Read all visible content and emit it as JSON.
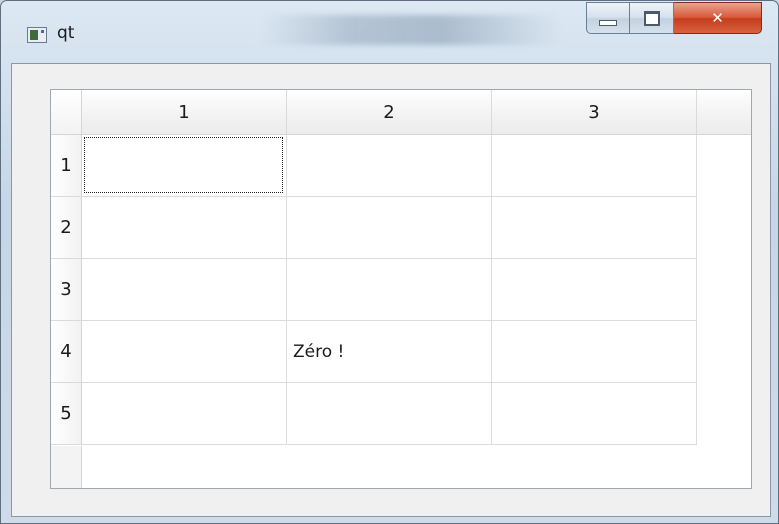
{
  "window": {
    "title": "qt"
  },
  "table": {
    "columns": [
      "1",
      "2",
      "3"
    ],
    "rows": [
      "1",
      "2",
      "3",
      "4",
      "5"
    ],
    "cells": [
      [
        "",
        "",
        ""
      ],
      [
        "",
        "",
        ""
      ],
      [
        "",
        "",
        ""
      ],
      [
        "",
        "Zéro !",
        ""
      ],
      [
        "",
        "",
        ""
      ]
    ],
    "focused_cell": {
      "row": 0,
      "col": 0
    }
  },
  "colors": {
    "close_button": "#c53c1c",
    "grid_line": "#dcdcdc",
    "header_background": "#f2f2f2"
  },
  "icons": {
    "app": "qt-window-icon",
    "minimize": "minimize-icon",
    "maximize": "maximize-icon",
    "close": "close-icon"
  }
}
